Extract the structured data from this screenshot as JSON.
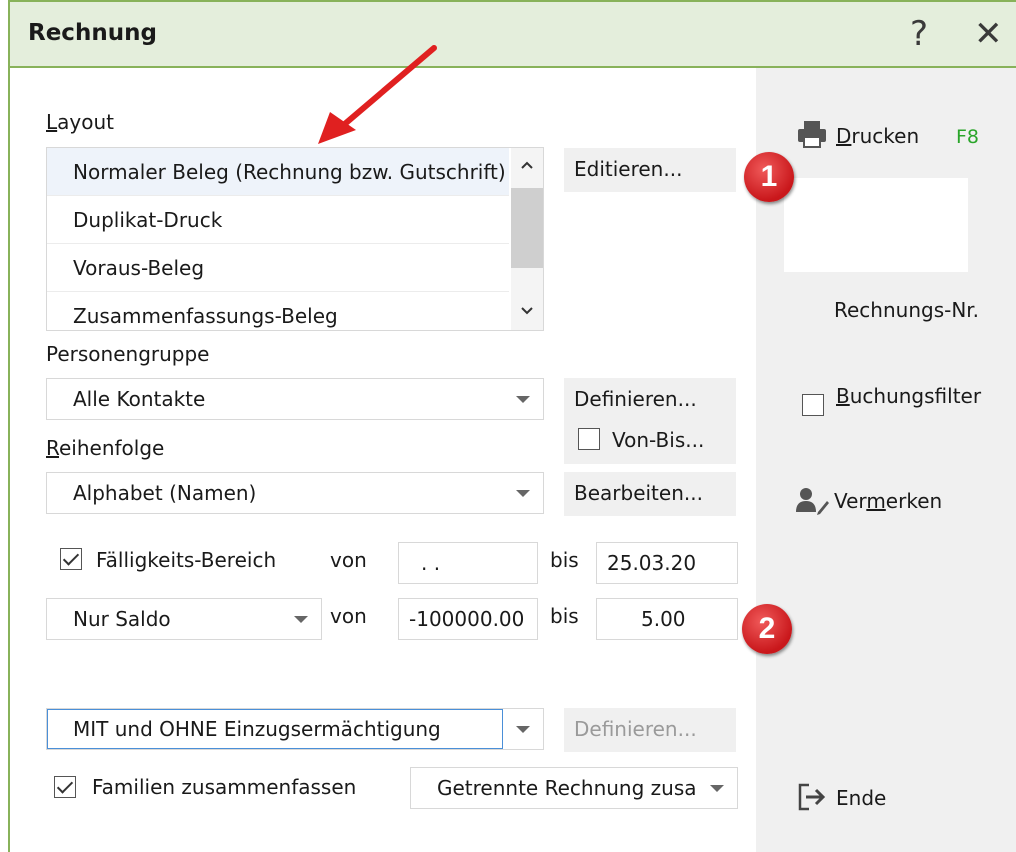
{
  "window": {
    "title": "Rechnung",
    "help_glyph": "?",
    "close_glyph": "✕"
  },
  "layout_section": {
    "label": "Layout",
    "items": [
      "Normaler Beleg (Rechnung bzw. Gutschrift)",
      "Duplikat-Druck",
      "Voraus-Beleg",
      "Zusammenfassungs-Beleg"
    ],
    "selected_index": 0,
    "edit_button": "Editieren..."
  },
  "personengruppe": {
    "label": "Personengruppe",
    "value": "Alle Kontakte",
    "define_button": "Definieren...",
    "von_bis_label": "Von-Bis...",
    "von_bis_checked": false
  },
  "reihenfolge": {
    "label": "Reihenfolge",
    "value": "Alphabet (Namen)",
    "edit_button": "Bearbeiten..."
  },
  "faelligkeit": {
    "checkbox_label": "Fälligkeits-Bereich",
    "checked": true,
    "von_label": "von",
    "von_value": ". .",
    "bis_label": "bis",
    "bis_value": "25.03.20"
  },
  "saldo": {
    "value": "Nur Saldo",
    "von_label": "von",
    "von_value": "-100000.00",
    "bis_label": "bis",
    "bis_value": "5.00"
  },
  "einzug": {
    "value": "MIT und OHNE Einzugsermächtigung",
    "define_button": "Definieren..."
  },
  "familien": {
    "checkbox_label": "Familien zusammenfassen",
    "checked": true,
    "dropdown_value": "Getrennte Rechnung zusammen"
  },
  "sidebar": {
    "print_label": "Drucken",
    "print_shortcut": "F8",
    "rechnungs_nr_label": "Rechnungs-Nr.",
    "buchungsfilter_label": "Buchungsfilter",
    "buchungsfilter_checked": false,
    "vermerken_label": "Vermerken",
    "ende_label": "Ende"
  },
  "annotations": {
    "badge1": "1",
    "badge2": "2",
    "arrow_color": "#e02020",
    "badge_color": "#d42a2a"
  },
  "colors": {
    "title_bg": "#e4eedc",
    "border_green": "#88b25a",
    "sidebar_bg": "#f0f0f0",
    "shortcut_green": "#2aa52a"
  }
}
